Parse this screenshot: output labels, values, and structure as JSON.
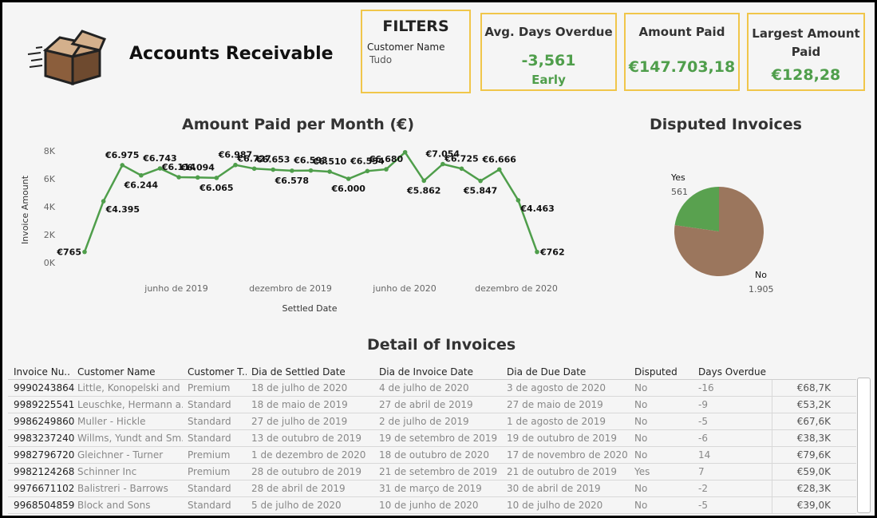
{
  "header": {
    "title": "Accounts Receivable",
    "logo_icon": "moving-box-icon"
  },
  "filters": {
    "heading": "FILTERS",
    "label": "Customer Name",
    "value": "Tudo"
  },
  "kpis": [
    {
      "title": "Avg. Days Overdue",
      "value": "-3,561",
      "sub": "Early"
    },
    {
      "title": "Amount Paid",
      "value": "€147.703,18"
    },
    {
      "title": "Largest Amount Paid",
      "value": "€128,28"
    }
  ],
  "colors": {
    "accent_green": "#4f9e4b",
    "card_border": "#f0c64a",
    "pie_no": "#9b765d",
    "pie_yes": "#59a14f"
  },
  "chart_data": [
    {
      "type": "line",
      "title": "Amount Paid per Month (€)",
      "xlabel": "Settled Date",
      "ylabel": "Invoice Amount",
      "ylim": [
        0,
        8000
      ],
      "y_ticks": [
        "0K",
        "2K",
        "4K",
        "6K",
        "8K"
      ],
      "x_ticks": [
        "junho de 2019",
        "dezembro de 2019",
        "junho de 2020",
        "dezembro de 2020"
      ],
      "series": [
        {
          "values": [
            765,
            4395,
            6975,
            6244,
            6743,
            6114,
            6094,
            6065,
            6987,
            6727,
            6653,
            6578,
            6593,
            6510,
            6000,
            6554,
            6680,
            7900,
            5862,
            7054,
            6725,
            5847,
            6666,
            4463,
            762
          ],
          "labels": [
            "€765",
            "€4.395",
            "€6.975",
            "€6.244",
            "€6.743",
            "€6.114",
            "€6.094",
            "€6.065",
            "€6.987",
            "€6.727",
            "€6.653",
            "€6.578",
            "€6.593",
            "€6.510",
            "€6.000",
            "€6.554",
            "€6.680",
            "",
            "€5.862",
            "€7.054",
            "€6.725",
            "€5.847",
            "€6.666",
            "€4.463",
            "€762"
          ]
        }
      ],
      "grid": false
    },
    {
      "type": "pie",
      "title": "Disputed Invoices",
      "slices": [
        {
          "label": "Yes",
          "value": 561,
          "display": "561"
        },
        {
          "label": "No",
          "value": 1905,
          "display": "1.905"
        }
      ]
    }
  ],
  "table": {
    "title": "Detail of Invoices",
    "columns": [
      "Invoice Nu..",
      "Customer Name",
      "Customer T..",
      "Dia de Settled Date",
      "Dia de Invoice Date",
      "Dia de Due Date",
      "Disputed",
      "Days Overdue",
      ""
    ],
    "rows": [
      [
        "9990243864",
        "Little, Konopelski and ..",
        "Premium",
        "18 de julho de 2020",
        "4 de julho de 2020",
        "3 de agosto de 2020",
        "No",
        "-16",
        "€68,7K"
      ],
      [
        "9989225541",
        "Leuschke, Hermann a..",
        "Standard",
        "18 de maio de 2019",
        "27 de abril de 2019",
        "27 de maio de 2019",
        "No",
        "-9",
        "€53,2K"
      ],
      [
        "9986249860",
        "Muller - Hickle",
        "Standard",
        "27 de julho de 2019",
        "2 de julho de 2019",
        "1 de agosto de 2019",
        "No",
        "-5",
        "€67,6K"
      ],
      [
        "9983237240",
        "Willms, Yundt and Sm..",
        "Standard",
        "13 de outubro de 2019",
        "19 de setembro de 2019",
        "19 de outubro de 2019",
        "No",
        "-6",
        "€38,3K"
      ],
      [
        "9982796720",
        "Gleichner - Turner",
        "Premium",
        "1 de dezembro de 2020",
        "18 de outubro de 2020",
        "17 de novembro de 2020",
        "No",
        "14",
        "€79,6K"
      ],
      [
        "9982124268",
        "Schinner Inc",
        "Premium",
        "28 de outubro de 2019",
        "21 de setembro de 2019",
        "21 de outubro de 2019",
        "Yes",
        "7",
        "€59,0K"
      ],
      [
        "9976671102",
        "Balistreri - Barrows",
        "Standard",
        "28 de abril de 2019",
        "31 de março de 2019",
        "30 de abril de 2019",
        "No",
        "-2",
        "€28,3K"
      ],
      [
        "9968504859",
        "Block and Sons",
        "Standard",
        "5 de julho de 2020",
        "10 de junho de 2020",
        "10 de julho de 2020",
        "No",
        "-5",
        "€39,0K"
      ]
    ]
  }
}
